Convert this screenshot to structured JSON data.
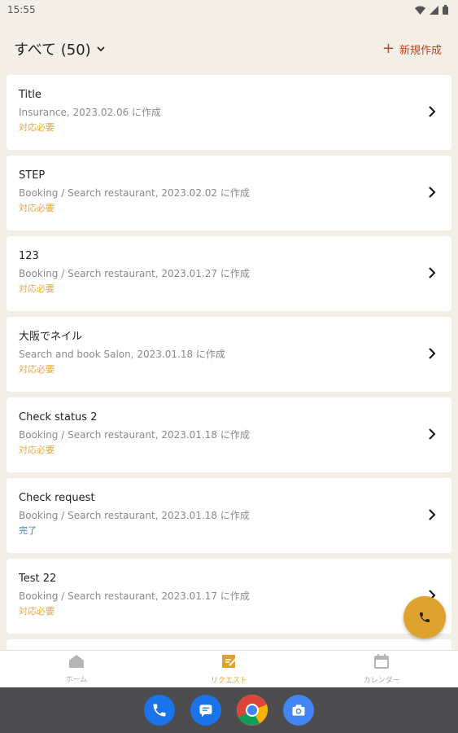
{
  "status_bar": {
    "time": "15:55"
  },
  "header": {
    "filter_label": "すべて (50)",
    "new_label": "新規作成"
  },
  "colors": {
    "accent": "#e0a22f",
    "new_button": "#c4431f",
    "status_pending": "#f0a33b",
    "status_done": "#3a7bd5"
  },
  "requests": [
    {
      "title": "Title",
      "meta": "Insurance,  2023.02.06 に作成",
      "status": "対応必要",
      "status_type": "pending"
    },
    {
      "title": "STEP",
      "meta": "Booking / Search restaurant,  2023.02.02 に作成",
      "status": "対応必要",
      "status_type": "pending"
    },
    {
      "title": "123",
      "meta": "Booking / Search restaurant,  2023.01.27 に作成",
      "status": "対応必要",
      "status_type": "pending"
    },
    {
      "title": "大阪でネイル",
      "meta": "Search and book Salon,  2023.01.18 に作成",
      "status": "対応必要",
      "status_type": "pending"
    },
    {
      "title": "Check status 2",
      "meta": "Booking / Search restaurant,  2023.01.18 に作成",
      "status": "対応必要",
      "status_type": "pending"
    },
    {
      "title": "Check request",
      "meta": "Booking / Search restaurant,  2023.01.18 に作成",
      "status": "完了",
      "status_type": "done"
    },
    {
      "title": "Test 22",
      "meta": "Booking / Search restaurant,  2023.01.17 に作成",
      "status": "対応必要",
      "status_type": "pending"
    }
  ],
  "tabs": [
    {
      "label": "ホーム",
      "icon": "home-icon",
      "active": false
    },
    {
      "label": "リクエスト",
      "icon": "request-icon",
      "active": true
    },
    {
      "label": "カレンダー",
      "icon": "calendar-icon",
      "active": false
    }
  ]
}
